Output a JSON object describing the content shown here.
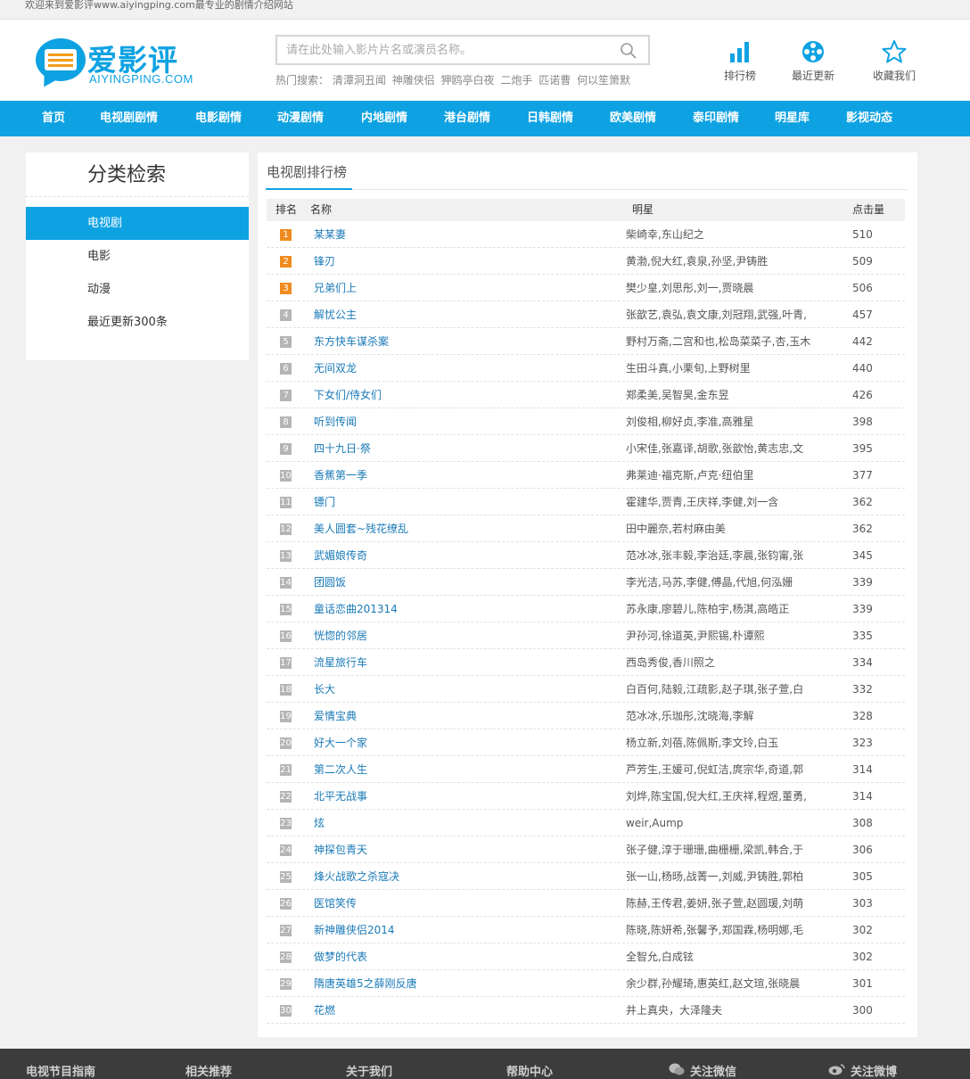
{
  "topbar": {
    "welcome": "欢迎来到爱影评www.aiyingping.com最专业的剧情介绍网站"
  },
  "logo": {
    "title": "爱影评",
    "subtitle": "AIYINGPING.COM"
  },
  "search": {
    "placeholder": "请在此处输入影片片名或演员名称。",
    "hot_label": "热门搜索：",
    "hot_terms": [
      "清潭洞丑闻",
      "神雕侠侣",
      "狎鸥亭白夜",
      "二炮手",
      "匹诺曹",
      "何以笙箫默"
    ]
  },
  "quick_links": [
    {
      "label": "排行榜",
      "icon": "bar-chart-icon"
    },
    {
      "label": "最近更新",
      "icon": "film-reel-icon"
    },
    {
      "label": "收藏我们",
      "icon": "star-icon"
    }
  ],
  "nav": [
    "首页",
    "电视剧剧情",
    "电影剧情",
    "动漫剧情",
    "内地剧情",
    "港台剧情",
    "日韩剧情",
    "欧美剧情",
    "泰印剧情",
    "明星库",
    "影视动态"
  ],
  "sidebar": {
    "title": "分类检索",
    "items": [
      "电视剧",
      "电影",
      "动漫",
      "最近更新300条"
    ]
  },
  "main": {
    "tab": "电视剧排行榜",
    "columns": {
      "rank": "排名",
      "name": "名称",
      "stars": "明星",
      "clicks": "点击量"
    },
    "rows": [
      {
        "rank": "1",
        "name": "某某妻",
        "stars": "柴崎幸,东山纪之",
        "clicks": "510"
      },
      {
        "rank": "2",
        "name": "锋刃",
        "stars": "黄渤,倪大红,袁泉,孙坚,尹铸胜",
        "clicks": "509"
      },
      {
        "rank": "3",
        "name": "兄弟们上",
        "stars": "樊少皇,刘思彤,刘一,贾晓晨",
        "clicks": "506"
      },
      {
        "rank": "4",
        "name": "解忧公主",
        "stars": "张歆艺,袁弘,袁文康,刘冠翔,武强,叶青,",
        "clicks": "457"
      },
      {
        "rank": "5",
        "name": "东方快车谋杀案",
        "stars": "野村万斋,二宫和也,松岛菜菜子,杏,玉木",
        "clicks": "442"
      },
      {
        "rank": "6",
        "name": "无间双龙",
        "stars": "生田斗真,小栗旬,上野树里",
        "clicks": "440"
      },
      {
        "rank": "7",
        "name": "下女们/侍女们",
        "stars": "郑柔美,吴智昊,金东昱",
        "clicks": "426"
      },
      {
        "rank": "8",
        "name": "听到传闻",
        "stars": "刘俊相,柳好贞,李准,高雅星",
        "clicks": "398"
      },
      {
        "rank": "9",
        "name": "四十九日·祭",
        "stars": "小宋佳,张嘉译,胡歌,张歆怡,黄志忠,文",
        "clicks": "395"
      },
      {
        "rank": "10",
        "name": "香蕉第一季",
        "stars": "弗莱迪·福克斯,卢克·纽伯里",
        "clicks": "377"
      },
      {
        "rank": "11",
        "name": "镖门",
        "stars": "霍建华,贾青,王庆祥,李健,刘一含",
        "clicks": "362"
      },
      {
        "rank": "12",
        "name": "美人圆套~残花缭乱",
        "stars": "田中麗奈,若村麻由美",
        "clicks": "362"
      },
      {
        "rank": "13",
        "name": "武媚娘传奇",
        "stars": "范冰冰,张丰毅,李治廷,李晨,张钧甯,张",
        "clicks": "345"
      },
      {
        "rank": "14",
        "name": "团圆饭",
        "stars": "李光洁,马苏,李健,傅晶,代旭,何泓姗",
        "clicks": "339"
      },
      {
        "rank": "15",
        "name": "童话恋曲201314",
        "stars": "苏永康,廖碧儿,陈柏宇,杨淇,高皓正",
        "clicks": "339"
      },
      {
        "rank": "16",
        "name": "恍惚的邻居",
        "stars": "尹孙河,徐道英,尹熙锡,朴谭熙",
        "clicks": "335"
      },
      {
        "rank": "17",
        "name": "流星旅行车",
        "stars": "西岛秀俊,香川照之",
        "clicks": "334"
      },
      {
        "rank": "18",
        "name": "长大",
        "stars": "白百何,陆毅,江疏影,赵子琪,张子萱,白",
        "clicks": "332"
      },
      {
        "rank": "19",
        "name": "爱情宝典",
        "stars": "范冰冰,乐珈彤,沈晓海,李解",
        "clicks": "328"
      },
      {
        "rank": "20",
        "name": "好大一个家",
        "stars": "杨立新,刘蓓,陈佩斯,李文玲,白玉",
        "clicks": "323"
      },
      {
        "rank": "21",
        "name": "第二次人生",
        "stars": "芦芳生,王媛可,倪虹洁,庹宗华,奇道,郭",
        "clicks": "314"
      },
      {
        "rank": "22",
        "name": "北平无战事",
        "stars": "刘烨,陈宝国,倪大红,王庆祥,程煜,董勇,",
        "clicks": "314"
      },
      {
        "rank": "23",
        "name": "炫",
        "stars": "weir,Aump",
        "clicks": "308"
      },
      {
        "rank": "24",
        "name": "神探包青天",
        "stars": "张子健,淳于珊珊,曲栅栅,梁凯,韩合,于",
        "clicks": "306"
      },
      {
        "rank": "25",
        "name": "烽火战歌之杀寇决",
        "stars": "张一山,杨旸,战菁一,刘威,尹铸胜,郭柏",
        "clicks": "305"
      },
      {
        "rank": "26",
        "name": "医馆笑传",
        "stars": "陈赫,王传君,姜妍,张子萱,赵圆瑗,刘萌",
        "clicks": "303"
      },
      {
        "rank": "27",
        "name": "新神雕侠侣2014",
        "stars": "陈晓,陈妍希,张馨予,郑国霖,杨明娜,毛",
        "clicks": "302"
      },
      {
        "rank": "28",
        "name": "做梦的代表",
        "stars": "全智允,白成铉",
        "clicks": "302"
      },
      {
        "rank": "29",
        "name": "隋唐英雄5之薛刚反唐",
        "stars": "余少群,孙耀琦,惠英红,赵文瑄,张晓晨",
        "clicks": "301"
      },
      {
        "rank": "30",
        "name": "花燃",
        "stars": "井上真央，大泽隆夫",
        "clicks": "300"
      }
    ]
  },
  "footer": [
    "电视节目指南",
    "相关推荐",
    "关于我们",
    "帮助中心",
    "关注微信",
    "关注微博"
  ],
  "colors": {
    "brand": "#0ea2e2",
    "top_rank": "#f08b1f",
    "rank": "#b5b5b5",
    "link": "#1a7ab8"
  }
}
